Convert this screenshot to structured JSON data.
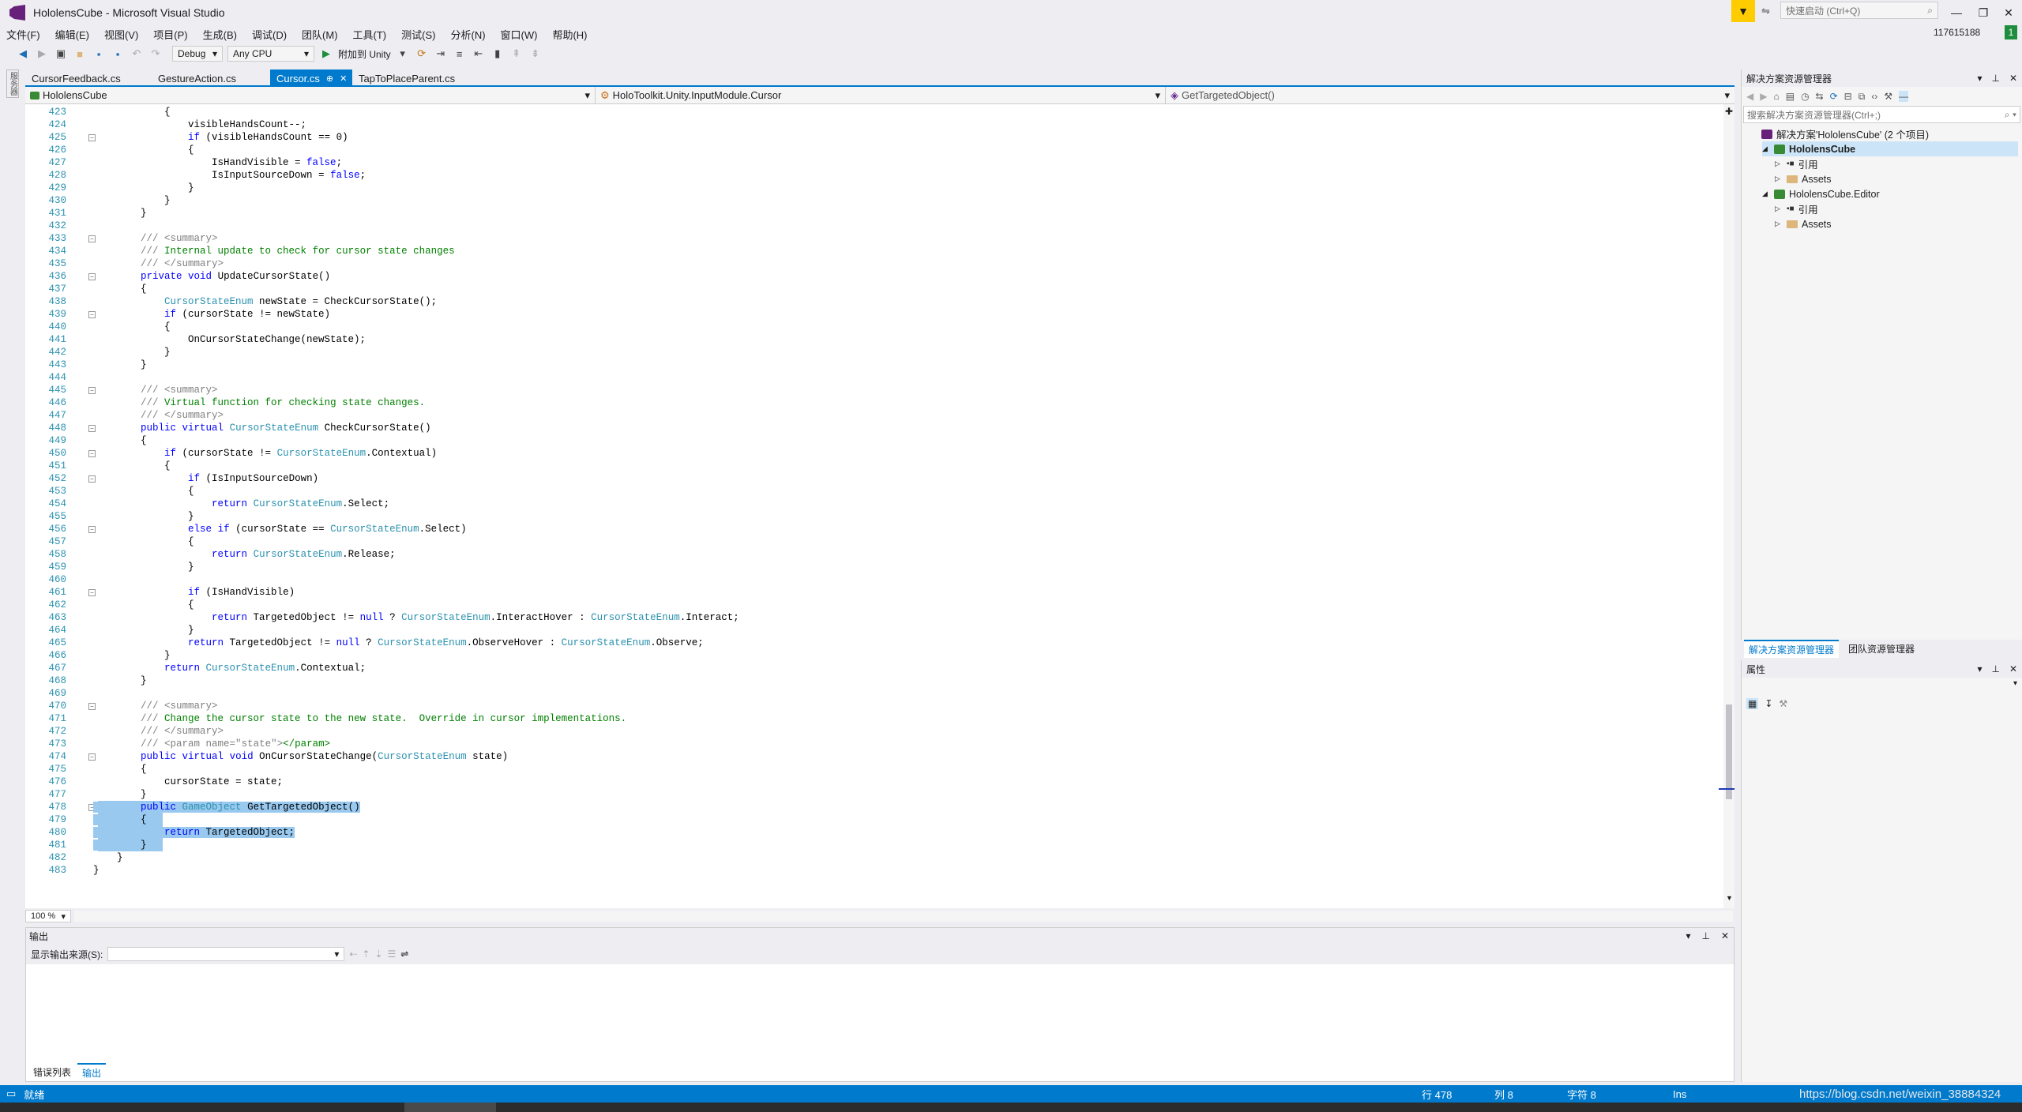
{
  "window": {
    "title": "HololensCube - Microsoft Visual Studio",
    "quick_launch_placeholder": "快速启动 (Ctrl+Q)",
    "account_id": "117615188",
    "notification_count": "1"
  },
  "menu": [
    "文件(F)",
    "编辑(E)",
    "视图(V)",
    "项目(P)",
    "生成(B)",
    "调试(D)",
    "团队(M)",
    "工具(T)",
    "测试(S)",
    "分析(N)",
    "窗口(W)",
    "帮助(H)"
  ],
  "toolbar": {
    "config": "Debug",
    "platform": "Any CPU",
    "run_label": "附加到 Unity"
  },
  "left_strip_label": "服务器",
  "tabs": [
    {
      "label": "CursorFeedback.cs",
      "active": false
    },
    {
      "label": "GestureAction.cs",
      "active": false
    },
    {
      "label": "Cursor.cs",
      "active": true
    },
    {
      "label": "TapToPlaceParent.cs",
      "active": false
    }
  ],
  "navbar": {
    "project": "HololensCube",
    "type": "HoloToolkit.Unity.InputModule.Cursor",
    "member": "GetTargetedObject()"
  },
  "code_lines": [
    {
      "n": "423",
      "t": "            {"
    },
    {
      "n": "424",
      "t": "                visibleHandsCount--;"
    },
    {
      "n": "425",
      "t": "                if (visibleHandsCount == 0)"
    },
    {
      "n": "426",
      "t": "                {"
    },
    {
      "n": "427",
      "t": "                    IsHandVisible = false;"
    },
    {
      "n": "428",
      "t": "                    IsInputSourceDown = false;"
    },
    {
      "n": "429",
      "t": "                }"
    },
    {
      "n": "430",
      "t": "            }"
    },
    {
      "n": "431",
      "t": "        }"
    },
    {
      "n": "432",
      "t": ""
    },
    {
      "n": "433",
      "t": "        /// <summary>"
    },
    {
      "n": "434",
      "t": "        /// Internal update to check for cursor state changes"
    },
    {
      "n": "435",
      "t": "        /// </summary>"
    },
    {
      "n": "436",
      "t": "        private void UpdateCursorState()"
    },
    {
      "n": "437",
      "t": "        {"
    },
    {
      "n": "438",
      "t": "            CursorStateEnum newState = CheckCursorState();"
    },
    {
      "n": "439",
      "t": "            if (cursorState != newState)"
    },
    {
      "n": "440",
      "t": "            {"
    },
    {
      "n": "441",
      "t": "                OnCursorStateChange(newState);"
    },
    {
      "n": "442",
      "t": "            }"
    },
    {
      "n": "443",
      "t": "        }"
    },
    {
      "n": "444",
      "t": ""
    },
    {
      "n": "445",
      "t": "        /// <summary>"
    },
    {
      "n": "446",
      "t": "        /// Virtual function for checking state changes."
    },
    {
      "n": "447",
      "t": "        /// </summary>"
    },
    {
      "n": "448",
      "t": "        public virtual CursorStateEnum CheckCursorState()"
    },
    {
      "n": "449",
      "t": "        {"
    },
    {
      "n": "450",
      "t": "            if (cursorState != CursorStateEnum.Contextual)"
    },
    {
      "n": "451",
      "t": "            {"
    },
    {
      "n": "452",
      "t": "                if (IsInputSourceDown)"
    },
    {
      "n": "453",
      "t": "                {"
    },
    {
      "n": "454",
      "t": "                    return CursorStateEnum.Select;"
    },
    {
      "n": "455",
      "t": "                }"
    },
    {
      "n": "456",
      "t": "                else if (cursorState == CursorStateEnum.Select)"
    },
    {
      "n": "457",
      "t": "                {"
    },
    {
      "n": "458",
      "t": "                    return CursorStateEnum.Release;"
    },
    {
      "n": "459",
      "t": "                }"
    },
    {
      "n": "460",
      "t": ""
    },
    {
      "n": "461",
      "t": "                if (IsHandVisible)"
    },
    {
      "n": "462",
      "t": "                {"
    },
    {
      "n": "463",
      "t": "                    return TargetedObject != null ? CursorStateEnum.InteractHover : CursorStateEnum.Interact;"
    },
    {
      "n": "464",
      "t": "                }"
    },
    {
      "n": "465",
      "t": "                return TargetedObject != null ? CursorStateEnum.ObserveHover : CursorStateEnum.Observe;"
    },
    {
      "n": "466",
      "t": "            }"
    },
    {
      "n": "467",
      "t": "            return CursorStateEnum.Contextual;"
    },
    {
      "n": "468",
      "t": "        }"
    },
    {
      "n": "469",
      "t": ""
    },
    {
      "n": "470",
      "t": "        /// <summary>"
    },
    {
      "n": "471",
      "t": "        /// Change the cursor state to the new state.  Override in cursor implementations."
    },
    {
      "n": "472",
      "t": "        /// </summary>"
    },
    {
      "n": "473",
      "t": "        /// <param name=\"state\"></param>"
    },
    {
      "n": "474",
      "t": "        public virtual void OnCursorStateChange(CursorStateEnum state)"
    },
    {
      "n": "475",
      "t": "        {"
    },
    {
      "n": "476",
      "t": "            cursorState = state;"
    },
    {
      "n": "477",
      "t": "        }"
    },
    {
      "n": "478",
      "t": "        public GameObject GetTargetedObject()"
    },
    {
      "n": "479",
      "t": "        {"
    },
    {
      "n": "480",
      "t": "            return TargetedObject;"
    },
    {
      "n": "481",
      "t": "        }"
    },
    {
      "n": "482",
      "t": "    }"
    },
    {
      "n": "483",
      "t": "}"
    }
  ],
  "zoom": "100 %",
  "output_panel": {
    "title": "输出",
    "source_label": "显示输出来源(S):",
    "source_value": ""
  },
  "bottom_tabs": [
    {
      "label": "错误列表",
      "active": false
    },
    {
      "label": "输出",
      "active": true
    }
  ],
  "solution_explorer": {
    "title": "解决方案资源管理器",
    "search_placeholder": "搜索解决方案资源管理器(Ctrl+;)",
    "items": [
      {
        "label": "解决方案'HololensCube' (2 个项目)",
        "kind": "solution",
        "depth": 0,
        "bold": false
      },
      {
        "label": "HololensCube",
        "kind": "project",
        "depth": 1,
        "bold": true
      },
      {
        "label": "引用",
        "kind": "ref",
        "depth": 2,
        "bold": false
      },
      {
        "label": "Assets",
        "kind": "folder",
        "depth": 2,
        "bold": false
      },
      {
        "label": "HololensCube.Editor",
        "kind": "project",
        "depth": 1,
        "bold": false
      },
      {
        "label": "引用",
        "kind": "ref",
        "depth": 2,
        "bold": false
      },
      {
        "label": "Assets",
        "kind": "folder",
        "depth": 2,
        "bold": false
      }
    ],
    "tabs": [
      "解决方案资源管理器",
      "团队资源管理器"
    ]
  },
  "properties": {
    "title": "属性"
  },
  "status": {
    "ready": "就绪",
    "line": "行 478",
    "col": "列 8",
    "char": "字符 8",
    "mode": "Ins",
    "watermark": "https://blog.csdn.net/weixin_38884324"
  },
  "colors": {
    "accent": "#007acc",
    "selection": "#99c9ef"
  }
}
